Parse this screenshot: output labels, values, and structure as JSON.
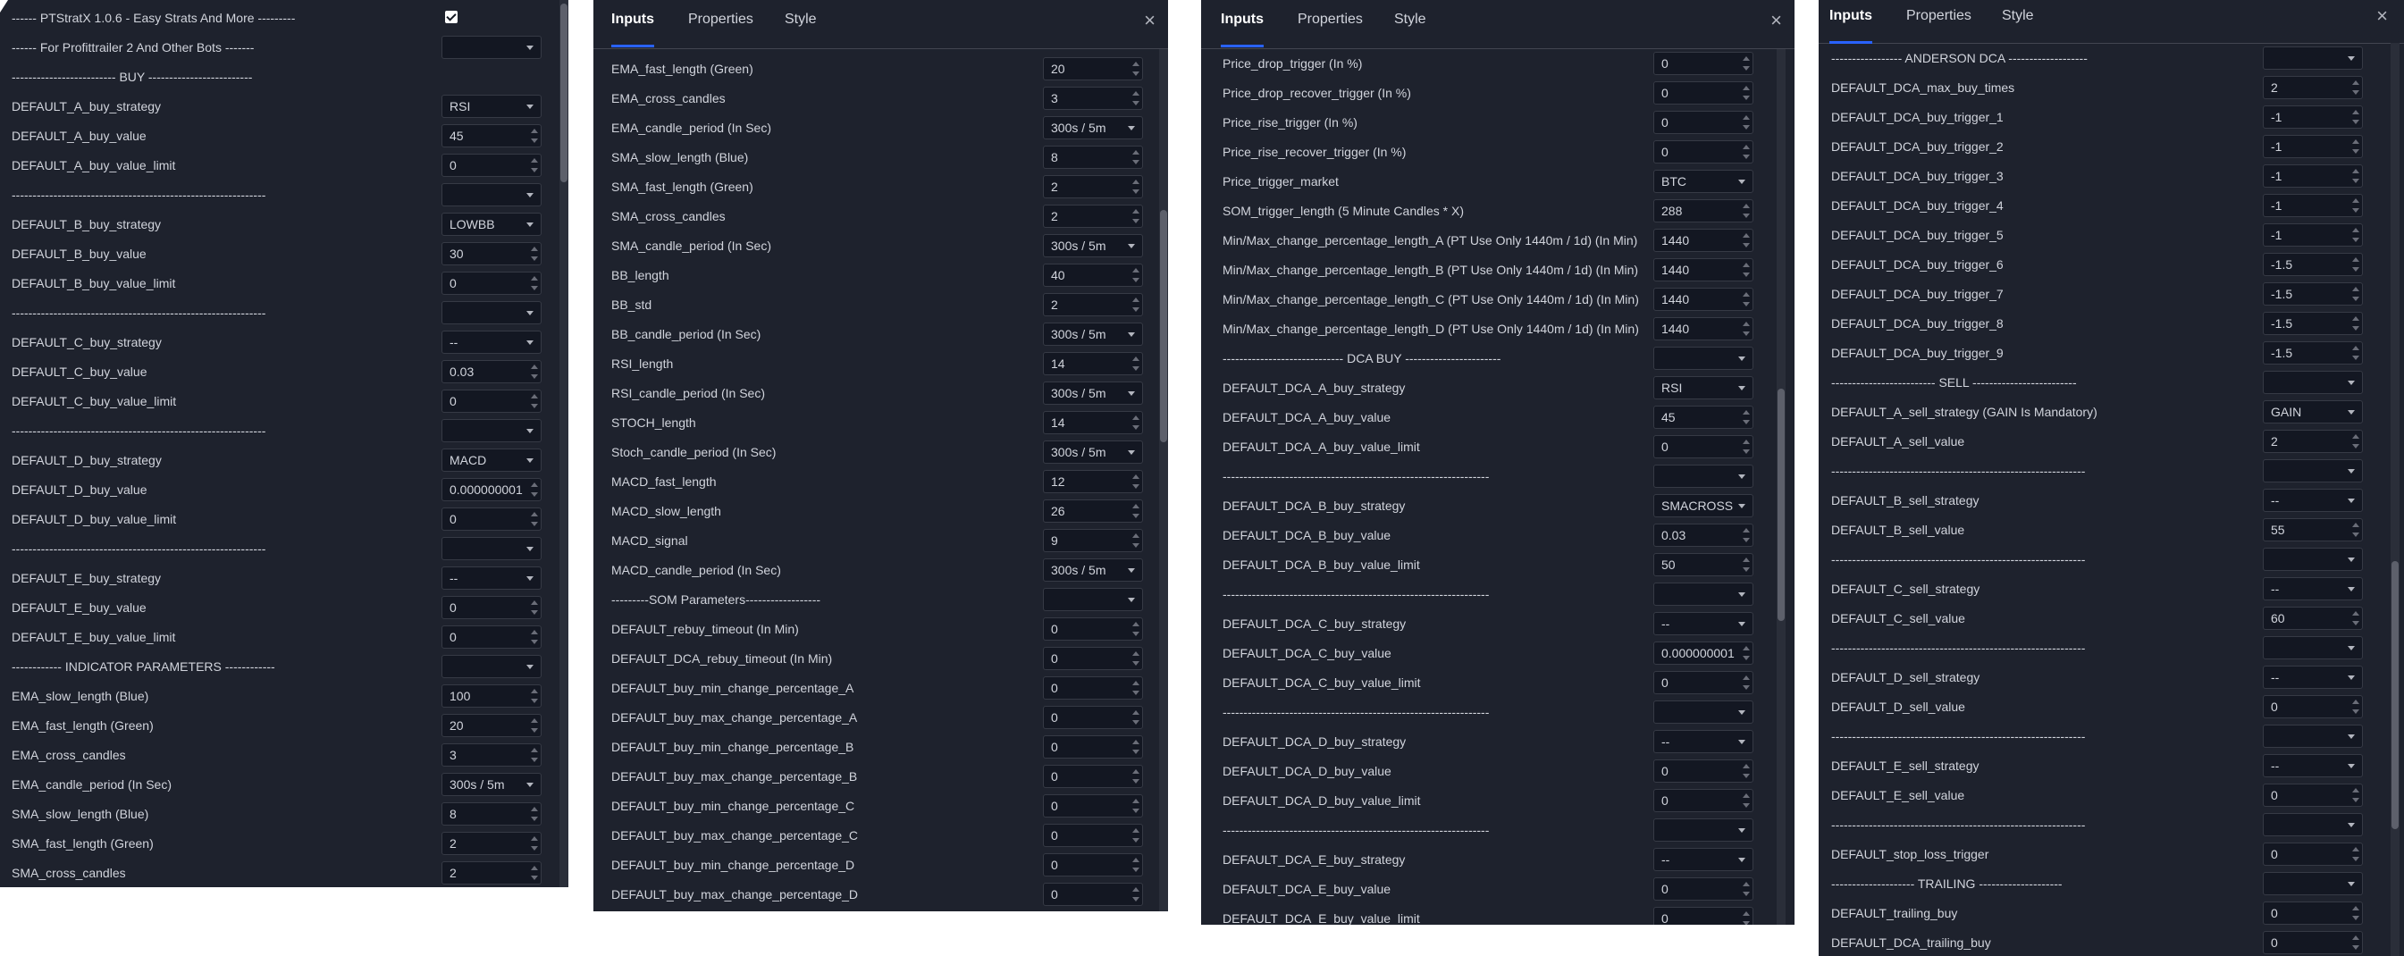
{
  "tabs": {
    "inputs": "Inputs",
    "properties": "Properties",
    "style": "Style"
  },
  "close_symbol": "×",
  "panel1": {
    "rows": [
      {
        "l": "------ PTStratX 1.0.6 - Easy Strats And More ---------",
        "t": "chk"
      },
      {
        "l": "------ For Profittrailer 2 And Other Bots -------",
        "t": "sel",
        "v": ""
      },
      {
        "l": "------------------------- BUY -------------------------",
        "t": "none"
      },
      {
        "l": "DEFAULT_A_buy_strategy",
        "t": "sel",
        "v": "RSI"
      },
      {
        "l": "DEFAULT_A_buy_value",
        "t": "num",
        "v": "45"
      },
      {
        "l": "DEFAULT_A_buy_value_limit",
        "t": "num",
        "v": "0"
      },
      {
        "l": "-------------------------------------------------------------",
        "t": "sel",
        "v": ""
      },
      {
        "l": "DEFAULT_B_buy_strategy",
        "t": "sel",
        "v": "LOWBB"
      },
      {
        "l": "DEFAULT_B_buy_value",
        "t": "num",
        "v": "30"
      },
      {
        "l": "DEFAULT_B_buy_value_limit",
        "t": "num",
        "v": "0"
      },
      {
        "l": "-------------------------------------------------------------",
        "t": "sel",
        "v": ""
      },
      {
        "l": "DEFAULT_C_buy_strategy",
        "t": "sel",
        "v": "--"
      },
      {
        "l": "DEFAULT_C_buy_value",
        "t": "num",
        "v": "0.03"
      },
      {
        "l": "DEFAULT_C_buy_value_limit",
        "t": "num",
        "v": "0"
      },
      {
        "l": "-------------------------------------------------------------",
        "t": "sel",
        "v": ""
      },
      {
        "l": "DEFAULT_D_buy_strategy",
        "t": "sel",
        "v": "MACD"
      },
      {
        "l": "DEFAULT_D_buy_value",
        "t": "num",
        "v": "0.000000001"
      },
      {
        "l": "DEFAULT_D_buy_value_limit",
        "t": "num",
        "v": "0"
      },
      {
        "l": "-------------------------------------------------------------",
        "t": "sel",
        "v": ""
      },
      {
        "l": "DEFAULT_E_buy_strategy",
        "t": "sel",
        "v": "--"
      },
      {
        "l": "DEFAULT_E_buy_value",
        "t": "num",
        "v": "0"
      },
      {
        "l": "DEFAULT_E_buy_value_limit",
        "t": "num",
        "v": "0"
      },
      {
        "l": "------------ INDICATOR PARAMETERS ------------",
        "t": "sel",
        "v": ""
      },
      {
        "l": "EMA_slow_length (Blue)",
        "t": "num",
        "v": "100"
      },
      {
        "l": "EMA_fast_length (Green)",
        "t": "num",
        "v": "20"
      },
      {
        "l": "EMA_cross_candles",
        "t": "num",
        "v": "3"
      },
      {
        "l": "EMA_candle_period (In Sec)",
        "t": "sel",
        "v": "300s / 5m"
      },
      {
        "l": "SMA_slow_length (Blue)",
        "t": "num",
        "v": "8"
      },
      {
        "l": "SMA_fast_length (Green)",
        "t": "num",
        "v": "2"
      },
      {
        "l": "SMA_cross_candles",
        "t": "num",
        "v": "2"
      }
    ]
  },
  "panel2": {
    "rows": [
      {
        "l": "EMA_fast_length (Green)",
        "t": "num",
        "v": "20"
      },
      {
        "l": "EMA_cross_candles",
        "t": "num",
        "v": "3"
      },
      {
        "l": "EMA_candle_period (In Sec)",
        "t": "sel",
        "v": "300s / 5m"
      },
      {
        "l": "SMA_slow_length (Blue)",
        "t": "num",
        "v": "8"
      },
      {
        "l": "SMA_fast_length (Green)",
        "t": "num",
        "v": "2"
      },
      {
        "l": "SMA_cross_candles",
        "t": "num",
        "v": "2"
      },
      {
        "l": "SMA_candle_period (In Sec)",
        "t": "sel",
        "v": "300s / 5m"
      },
      {
        "l": "BB_length",
        "t": "num",
        "v": "40"
      },
      {
        "l": "BB_std",
        "t": "num",
        "v": "2"
      },
      {
        "l": "BB_candle_period (In Sec)",
        "t": "sel",
        "v": "300s / 5m"
      },
      {
        "l": "RSI_length",
        "t": "num",
        "v": "14"
      },
      {
        "l": "RSI_candle_period (In Sec)",
        "t": "sel",
        "v": "300s / 5m"
      },
      {
        "l": "STOCH_length",
        "t": "num",
        "v": "14"
      },
      {
        "l": "Stoch_candle_period (In Sec)",
        "t": "sel",
        "v": "300s / 5m"
      },
      {
        "l": "MACD_fast_length",
        "t": "num",
        "v": "12"
      },
      {
        "l": "MACD_slow_length",
        "t": "num",
        "v": "26"
      },
      {
        "l": "MACD_signal",
        "t": "num",
        "v": "9"
      },
      {
        "l": "MACD_candle_period (In Sec)",
        "t": "sel",
        "v": "300s / 5m"
      },
      {
        "l": "---------SOM Parameters------------------",
        "t": "sel",
        "v": ""
      },
      {
        "l": "DEFAULT_rebuy_timeout (In Min)",
        "t": "num",
        "v": "0"
      },
      {
        "l": "DEFAULT_DCA_rebuy_timeout (In Min)",
        "t": "num",
        "v": "0"
      },
      {
        "l": "DEFAULT_buy_min_change_percentage_A",
        "t": "num",
        "v": "0"
      },
      {
        "l": "DEFAULT_buy_max_change_percentage_A",
        "t": "num",
        "v": "0"
      },
      {
        "l": "DEFAULT_buy_min_change_percentage_B",
        "t": "num",
        "v": "0"
      },
      {
        "l": "DEFAULT_buy_max_change_percentage_B",
        "t": "num",
        "v": "0"
      },
      {
        "l": "DEFAULT_buy_min_change_percentage_C",
        "t": "num",
        "v": "0"
      },
      {
        "l": "DEFAULT_buy_max_change_percentage_C",
        "t": "num",
        "v": "0"
      },
      {
        "l": "DEFAULT_buy_min_change_percentage_D",
        "t": "num",
        "v": "0"
      },
      {
        "l": "DEFAULT_buy_max_change_percentage_D",
        "t": "num",
        "v": "0"
      }
    ]
  },
  "panel3": {
    "rows": [
      {
        "l": "Price_drop_trigger (In %)",
        "t": "num",
        "v": "0"
      },
      {
        "l": "Price_drop_recover_trigger (In %)",
        "t": "num",
        "v": "0"
      },
      {
        "l": "Price_rise_trigger (In %)",
        "t": "num",
        "v": "0"
      },
      {
        "l": "Price_rise_recover_trigger (In %)",
        "t": "num",
        "v": "0"
      },
      {
        "l": "Price_trigger_market",
        "t": "sel",
        "v": "BTC"
      },
      {
        "l": "SOM_trigger_length (5 Minute Candles * X)",
        "t": "num",
        "v": "288"
      },
      {
        "l": "Min/Max_change_percentage_length_A (PT Use Only 1440m / 1d) (In Min)",
        "t": "num",
        "v": "1440"
      },
      {
        "l": "Min/Max_change_percentage_length_B (PT Use Only 1440m / 1d) (In Min)",
        "t": "num",
        "v": "1440"
      },
      {
        "l": "Min/Max_change_percentage_length_C (PT Use Only 1440m / 1d) (In Min)",
        "t": "num",
        "v": "1440"
      },
      {
        "l": "Min/Max_change_percentage_length_D (PT Use Only 1440m / 1d) (In Min)",
        "t": "num",
        "v": "1440"
      },
      {
        "l": "----------------------------- DCA BUY -----------------------",
        "t": "sel",
        "v": ""
      },
      {
        "l": "DEFAULT_DCA_A_buy_strategy",
        "t": "sel",
        "v": "RSI"
      },
      {
        "l": "DEFAULT_DCA_A_buy_value",
        "t": "num",
        "v": "45"
      },
      {
        "l": "DEFAULT_DCA_A_buy_value_limit",
        "t": "num",
        "v": "0"
      },
      {
        "l": "----------------------------------------------------------------",
        "t": "sel",
        "v": ""
      },
      {
        "l": "DEFAULT_DCA_B_buy_strategy",
        "t": "sel",
        "v": "SMACROSS"
      },
      {
        "l": "DEFAULT_DCA_B_buy_value",
        "t": "num",
        "v": "0.03"
      },
      {
        "l": "DEFAULT_DCA_B_buy_value_limit",
        "t": "num",
        "v": "50"
      },
      {
        "l": "----------------------------------------------------------------",
        "t": "sel",
        "v": ""
      },
      {
        "l": "DEFAULT_DCA_C_buy_strategy",
        "t": "sel",
        "v": "--"
      },
      {
        "l": "DEFAULT_DCA_C_buy_value",
        "t": "num",
        "v": "0.000000001"
      },
      {
        "l": "DEFAULT_DCA_C_buy_value_limit",
        "t": "num",
        "v": "0"
      },
      {
        "l": "----------------------------------------------------------------",
        "t": "sel",
        "v": ""
      },
      {
        "l": "DEFAULT_DCA_D_buy_strategy",
        "t": "sel",
        "v": "--"
      },
      {
        "l": "DEFAULT_DCA_D_buy_value",
        "t": "num",
        "v": "0"
      },
      {
        "l": "DEFAULT_DCA_D_buy_value_limit",
        "t": "num",
        "v": "0"
      },
      {
        "l": "----------------------------------------------------------------",
        "t": "sel",
        "v": ""
      },
      {
        "l": "DEFAULT_DCA_E_buy_strategy",
        "t": "sel",
        "v": "--"
      },
      {
        "l": "DEFAULT_DCA_E_buy_value",
        "t": "num",
        "v": "0"
      },
      {
        "l": "DEFAULT_DCA_E_buy_value_limit",
        "t": "num",
        "v": "0"
      }
    ]
  },
  "panel4": {
    "rows": [
      {
        "l": "----------------- ANDERSON DCA -------------------",
        "t": "sel",
        "v": ""
      },
      {
        "l": "DEFAULT_DCA_max_buy_times",
        "t": "num",
        "v": "2"
      },
      {
        "l": "DEFAULT_DCA_buy_trigger_1",
        "t": "num",
        "v": "-1"
      },
      {
        "l": "DEFAULT_DCA_buy_trigger_2",
        "t": "num",
        "v": "-1"
      },
      {
        "l": "DEFAULT_DCA_buy_trigger_3",
        "t": "num",
        "v": "-1"
      },
      {
        "l": "DEFAULT_DCA_buy_trigger_4",
        "t": "num",
        "v": "-1"
      },
      {
        "l": "DEFAULT_DCA_buy_trigger_5",
        "t": "num",
        "v": "-1"
      },
      {
        "l": "DEFAULT_DCA_buy_trigger_6",
        "t": "num",
        "v": "-1.5"
      },
      {
        "l": "DEFAULT_DCA_buy_trigger_7",
        "t": "num",
        "v": "-1.5"
      },
      {
        "l": "DEFAULT_DCA_buy_trigger_8",
        "t": "num",
        "v": "-1.5"
      },
      {
        "l": "DEFAULT_DCA_buy_trigger_9",
        "t": "num",
        "v": "-1.5"
      },
      {
        "l": "------------------------- SELL -------------------------",
        "t": "sel",
        "v": ""
      },
      {
        "l": "DEFAULT_A_sell_strategy (GAIN Is Mandatory)",
        "t": "sel",
        "v": "GAIN"
      },
      {
        "l": "DEFAULT_A_sell_value",
        "t": "num",
        "v": "2"
      },
      {
        "l": "-------------------------------------------------------------",
        "t": "sel",
        "v": ""
      },
      {
        "l": "DEFAULT_B_sell_strategy",
        "t": "sel",
        "v": "--"
      },
      {
        "l": "DEFAULT_B_sell_value",
        "t": "num",
        "v": "55"
      },
      {
        "l": "-------------------------------------------------------------",
        "t": "sel",
        "v": ""
      },
      {
        "l": "DEFAULT_C_sell_strategy",
        "t": "sel",
        "v": "--"
      },
      {
        "l": "DEFAULT_C_sell_value",
        "t": "num",
        "v": "60"
      },
      {
        "l": "-------------------------------------------------------------",
        "t": "sel",
        "v": ""
      },
      {
        "l": "DEFAULT_D_sell_strategy",
        "t": "sel",
        "v": "--"
      },
      {
        "l": "DEFAULT_D_sell_value",
        "t": "num",
        "v": "0"
      },
      {
        "l": "-------------------------------------------------------------",
        "t": "sel",
        "v": ""
      },
      {
        "l": "DEFAULT_E_sell_strategy",
        "t": "sel",
        "v": "--"
      },
      {
        "l": "DEFAULT_E_sell_value",
        "t": "num",
        "v": "0"
      },
      {
        "l": "-------------------------------------------------------------",
        "t": "sel",
        "v": ""
      },
      {
        "l": "DEFAULT_stop_loss_trigger",
        "t": "num",
        "v": "0"
      },
      {
        "l": "-------------------- TRAILING --------------------",
        "t": "sel",
        "v": ""
      },
      {
        "l": "DEFAULT_trailing_buy",
        "t": "num",
        "v": "0"
      },
      {
        "l": "DEFAULT_DCA_trailing_buy",
        "t": "num",
        "v": "0"
      }
    ]
  }
}
